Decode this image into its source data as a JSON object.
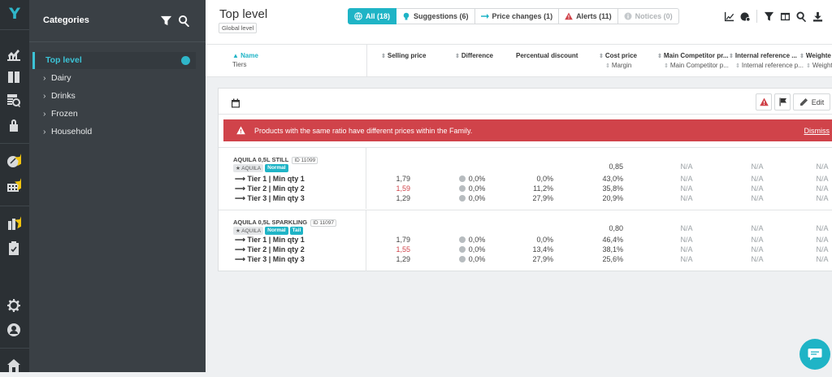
{
  "app": {
    "logo": "Y"
  },
  "categories": {
    "title": "Categories",
    "items": [
      {
        "label": "Top level",
        "active": true
      },
      {
        "label": "Dairy"
      },
      {
        "label": "Drinks"
      },
      {
        "label": "Frozen"
      },
      {
        "label": "Household"
      }
    ]
  },
  "header": {
    "title": "Top level",
    "subtitle": "Global level",
    "filters": [
      {
        "label": "All (18)",
        "icon": "globe-icon"
      },
      {
        "label": "Suggestions (6)",
        "icon": "lightbulb-icon"
      },
      {
        "label": "Price changes (1)",
        "icon": "arrow-right-icon"
      },
      {
        "label": "Alerts (11)",
        "icon": "warning-icon"
      },
      {
        "label": "Notices (0)",
        "icon": "info-icon"
      }
    ]
  },
  "columns": {
    "name": "Name",
    "name_sub": "Tiers",
    "selling_price": "Selling price",
    "difference": "Difference",
    "percentual_discount": "Percentual discount",
    "cost_price": "Cost price",
    "cost_price_sub": "Margin",
    "main_competitor": "Main Competitor pr...",
    "main_competitor_sub": "Main Competitor p...",
    "internal_reference": "Internal reference ...",
    "internal_reference_sub": "Internal reference p...",
    "weighted": "Weighte",
    "weighted_sub": "Weighte"
  },
  "card": {
    "edit_label": "Edit",
    "alert_text": "Products with the same ratio have different prices within the Family.",
    "dismiss_label": "Dismiss"
  },
  "products": [
    {
      "name": "AQUILA 0,5L STILL",
      "id": "ID 11099",
      "brand": "AQUILA",
      "tags": [
        "Normal"
      ],
      "cost": "0,85",
      "comp": "N/A",
      "ref": "N/A",
      "w": "N/A",
      "tiers": [
        {
          "label": "Tier 1 | Min qty 1",
          "price": "1,79",
          "price_red": false,
          "diff": "0,0%",
          "disc": "0,0%",
          "margin": "43,0%",
          "comp": "N/A",
          "ref": "N/A",
          "w": "N/A"
        },
        {
          "label": "Tier 2 | Min qty 2",
          "price": "1,59",
          "price_red": true,
          "diff": "0,0%",
          "disc": "11,2%",
          "margin": "35,8%",
          "comp": "N/A",
          "ref": "N/A",
          "w": "N/A"
        },
        {
          "label": "Tier 3 | Min qty 3",
          "price": "1,29",
          "price_red": false,
          "diff": "0,0%",
          "disc": "27,9%",
          "margin": "20,9%",
          "comp": "N/A",
          "ref": "N/A",
          "w": "N/A"
        }
      ]
    },
    {
      "name": "AQUILA 0,5L SPARKLING",
      "id": "ID 11097",
      "brand": "AQUILA",
      "tags": [
        "Normal",
        "Tail"
      ],
      "cost": "0,80",
      "comp": "N/A",
      "ref": "N/A",
      "w": "N/A",
      "tiers": [
        {
          "label": "Tier 1 | Min qty 1",
          "price": "1,79",
          "price_red": false,
          "diff": "0,0%",
          "disc": "0,0%",
          "margin": "46,4%",
          "comp": "N/A",
          "ref": "N/A",
          "w": "N/A"
        },
        {
          "label": "Tier 2 | Min qty 2",
          "price": "1,55",
          "price_red": true,
          "diff": "0,0%",
          "disc": "13,4%",
          "margin": "38,1%",
          "comp": "N/A",
          "ref": "N/A",
          "w": "N/A"
        },
        {
          "label": "Tier 3 | Min qty 3",
          "price": "1,29",
          "price_red": false,
          "diff": "0,0%",
          "disc": "27,9%",
          "margin": "25,6%",
          "comp": "N/A",
          "ref": "N/A",
          "w": "N/A"
        }
      ]
    }
  ],
  "colors": {
    "accent": "#1fb4c6",
    "alert": "#d0434a",
    "rail": "#2b3034",
    "panel": "#3a4045"
  }
}
